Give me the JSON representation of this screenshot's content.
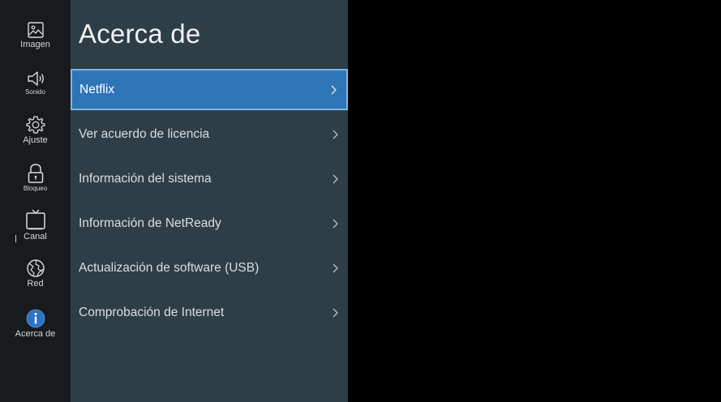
{
  "rail": {
    "items": [
      {
        "label": "Imagen",
        "icon": "picture-icon"
      },
      {
        "label": "Sonido",
        "icon": "speaker-icon"
      },
      {
        "label": "Ajuste",
        "icon": "gear-icon"
      },
      {
        "label": "Bloqueo",
        "icon": "lock-icon"
      },
      {
        "label": "Canal",
        "icon": "tv-icon"
      },
      {
        "label": "Red",
        "icon": "globe-icon"
      },
      {
        "label": "Acerca de",
        "icon": "info-icon",
        "active": true
      }
    ]
  },
  "panel": {
    "title": "Acerca de",
    "items": [
      {
        "label": "Netflix",
        "selected": true
      },
      {
        "label": "Ver acuerdo de licencia"
      },
      {
        "label": "Información del sistema"
      },
      {
        "label": "Información de NetReady"
      },
      {
        "label": "Actualización de software (USB)"
      },
      {
        "label": "Comprobación de Internet"
      }
    ]
  },
  "colors": {
    "rail_bg": "#171b1d",
    "panel_bg": "#2e3e46",
    "selected_bg": "#2d75b6",
    "selected_border": "#7fb6e6",
    "info_accent": "#2d73c4",
    "screen_bg": "#000000"
  }
}
